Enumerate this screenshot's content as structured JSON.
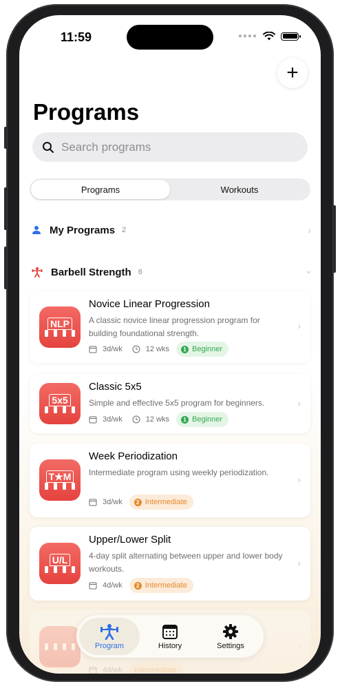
{
  "status_bar": {
    "time": "11:59"
  },
  "header": {
    "title": "Programs",
    "add_label": "+"
  },
  "search": {
    "placeholder": "Search programs"
  },
  "segmented": {
    "options": [
      "Programs",
      "Workouts"
    ],
    "selected": "Programs"
  },
  "sections": [
    {
      "label": "My Programs",
      "count": "2",
      "icon": "person-icon",
      "color": "#2f6fe4"
    },
    {
      "label": "Barbell Strength",
      "count": "6",
      "icon": "weightlifter-icon",
      "color": "#e5433f"
    }
  ],
  "programs": [
    {
      "abbr": "NLP",
      "title": "Novice Linear Progression",
      "description": "A classic novice linear progression program for building foundational strength.",
      "frequency": "3d/wk",
      "duration": "12 wks",
      "level": "Beginner",
      "level_num": "1"
    },
    {
      "abbr": "5x5",
      "title": "Classic 5x5",
      "description": "Simple and effective 5x5 program for beginners.",
      "frequency": "3d/wk",
      "duration": "12 wks",
      "level": "Beginner",
      "level_num": "1"
    },
    {
      "abbr": "T★M",
      "title": "Week Periodization",
      "description": "Intermediate program using weekly periodization.",
      "frequency": "3d/wk",
      "level": "Intermediate",
      "level_num": "2"
    },
    {
      "abbr": "U/L",
      "title": "Upper/Lower Split",
      "description": "4-day split alternating between upper and lower body workouts.",
      "frequency": "4d/wk",
      "level": "Intermediate",
      "level_num": "2"
    },
    {
      "frequency": "4d/wk",
      "level": "Intermediate"
    }
  ],
  "tabbar": {
    "items": [
      "Program",
      "History",
      "Settings"
    ],
    "selected": "Program"
  },
  "colors": {
    "accent": "#2f6fe4",
    "brand_red": "#e5433f",
    "beginner": "#34a853",
    "intermediate": "#e5892e"
  }
}
